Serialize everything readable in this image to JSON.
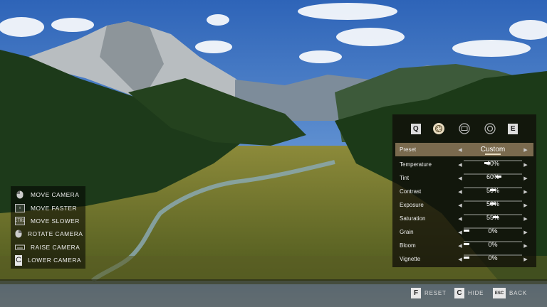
{
  "controls": [
    {
      "key_icon": "mouse-left-icon",
      "key_text": "",
      "label": "MOVE CAMERA"
    },
    {
      "key_icon": "shift-key-icon",
      "key_text": "⇧",
      "label": "MOVE FASTER"
    },
    {
      "key_icon": "ctrl-key-icon",
      "key_text": "CTRL",
      "label": "MOVE SLOWER"
    },
    {
      "key_icon": "mouse-right-icon",
      "key_text": "",
      "label": "ROTATE CAMERA"
    },
    {
      "key_icon": "spacebar-key-icon",
      "key_text": "",
      "label": "RAISE CAMERA"
    },
    {
      "key_icon": "c-key-icon",
      "key_text": "C",
      "label": "LOWER CAMERA"
    }
  ],
  "tabs": {
    "prev_key": "Q",
    "next_key": "E",
    "icons": [
      "aperture-icon",
      "film-icon",
      "frame-icon"
    ],
    "selected": 0
  },
  "preset": {
    "label": "Preset",
    "value": "Custom"
  },
  "settings": [
    {
      "label": "Temperature",
      "value": "40%",
      "level": 40
    },
    {
      "label": "Tint",
      "value": "60%",
      "level": 60
    },
    {
      "label": "Contrast",
      "value": "50%",
      "level": 50
    },
    {
      "label": "Exposure",
      "value": "50%",
      "level": 50
    },
    {
      "label": "Saturation",
      "value": "55%",
      "level": 55
    },
    {
      "label": "Grain",
      "value": "0%",
      "level": 0
    },
    {
      "label": "Bloom",
      "value": "0%",
      "level": 0
    },
    {
      "label": "Vignette",
      "value": "0%",
      "level": 0
    }
  ],
  "bottom": {
    "reset": {
      "key": "F",
      "label": "RESET"
    },
    "hide": {
      "key": "C",
      "label": "HIDE"
    },
    "back": {
      "key": "ESC",
      "label": "BACK"
    }
  },
  "colors": {
    "accent": "#e8dcc0",
    "preset_bg": "#7a6a4e"
  }
}
